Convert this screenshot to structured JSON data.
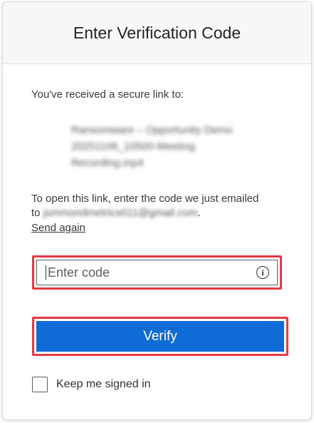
{
  "dialog": {
    "title": "Enter Verification Code",
    "received_text": "You've received a secure link to:",
    "filename_blurred": "Ransomware – Opportunity Demo 20251106_10500-Meeting Recording.mp4",
    "instruction_prefix": "To open this link, enter the code we just emailed to",
    "email_blurred": "jsmmondmetrics011@gmail.com",
    "instruction_suffix": ".",
    "send_again_label": "Send again",
    "code_placeholder": "Enter code",
    "verify_label": "Verify",
    "keep_signed_in_label": "Keep me signed in",
    "keep_signed_in_checked": false
  },
  "colors": {
    "primary_button": "#0f6cd7",
    "highlight_border": "#e23b43",
    "header_bg": "#f8f8f8"
  },
  "icons": {
    "code_info": "info-icon"
  }
}
